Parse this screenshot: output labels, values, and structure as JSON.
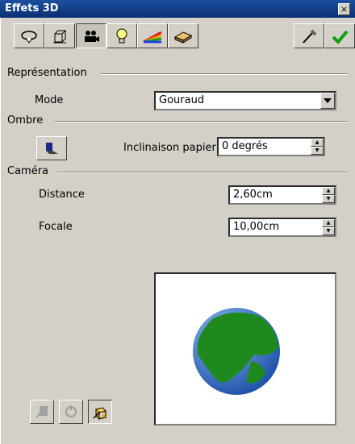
{
  "window": {
    "title": "Effets 3D",
    "close_label": "×"
  },
  "toolbar": {
    "buttons": [
      {
        "name": "geometry",
        "icon": "geometry-icon"
      },
      {
        "name": "representation",
        "icon": "shading-cube-icon"
      },
      {
        "name": "illumination-camera",
        "icon": "camera-icon",
        "pressed": true
      },
      {
        "name": "lighting",
        "icon": "bulb-icon"
      },
      {
        "name": "textures",
        "icon": "rainbow-icon"
      },
      {
        "name": "material",
        "icon": "material-icon"
      }
    ],
    "right_buttons": [
      {
        "name": "pipette",
        "icon": "pipette-icon"
      },
      {
        "name": "apply",
        "icon": "checkmark-icon"
      }
    ]
  },
  "sections": {
    "representation": "Représentation",
    "shadow": "Ombre",
    "camera": "Caméra"
  },
  "mode": {
    "label": "Mode",
    "value": "Gouraud"
  },
  "shadow": {
    "slant_label": "Inclinaison papier",
    "slant_value": "0 degrés"
  },
  "camera": {
    "distance_label": "Distance",
    "distance_value": "2,60cm",
    "focal_label": "Focale",
    "focal_value": "10,00cm"
  },
  "colors": {
    "title_bar": "#0a2f74",
    "globe_land": "#1e8a1e",
    "globe_water": "#3a78c8"
  }
}
